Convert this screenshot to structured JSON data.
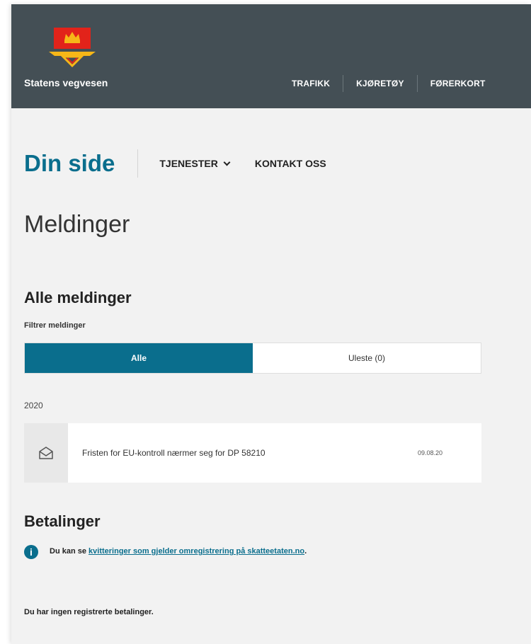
{
  "header": {
    "brand": "Statens vegvesen",
    "nav": [
      "TRAFIKK",
      "KJØRETØY",
      "FØRERKORT"
    ]
  },
  "subnav": {
    "title": "Din side",
    "items": [
      "TJENESTER",
      "KONTAKT OSS"
    ]
  },
  "page": {
    "title": "Meldinger"
  },
  "messages": {
    "section_title": "Alle meldinger",
    "filter_label": "Filtrer meldinger",
    "filters": [
      {
        "label": "Alle",
        "active": true
      },
      {
        "label": "Uleste (0)",
        "active": false
      }
    ],
    "year": "2020",
    "items": [
      {
        "icon": "envelope-open-icon",
        "text": "Fristen for EU-kontroll nærmer seg for DP 58210",
        "date": "09.08.20"
      }
    ]
  },
  "payments": {
    "section_title": "Betalinger",
    "info_prefix": "Du kan se ",
    "info_link": "kvitteringer som gjelder omregistrering på skatteetaten.no",
    "info_suffix": ".",
    "empty_text": "Du har ingen registrerte betalinger."
  },
  "colors": {
    "header_bg": "#444f55",
    "accent": "#0a6e8d",
    "page_bg": "#f2f2f2"
  }
}
